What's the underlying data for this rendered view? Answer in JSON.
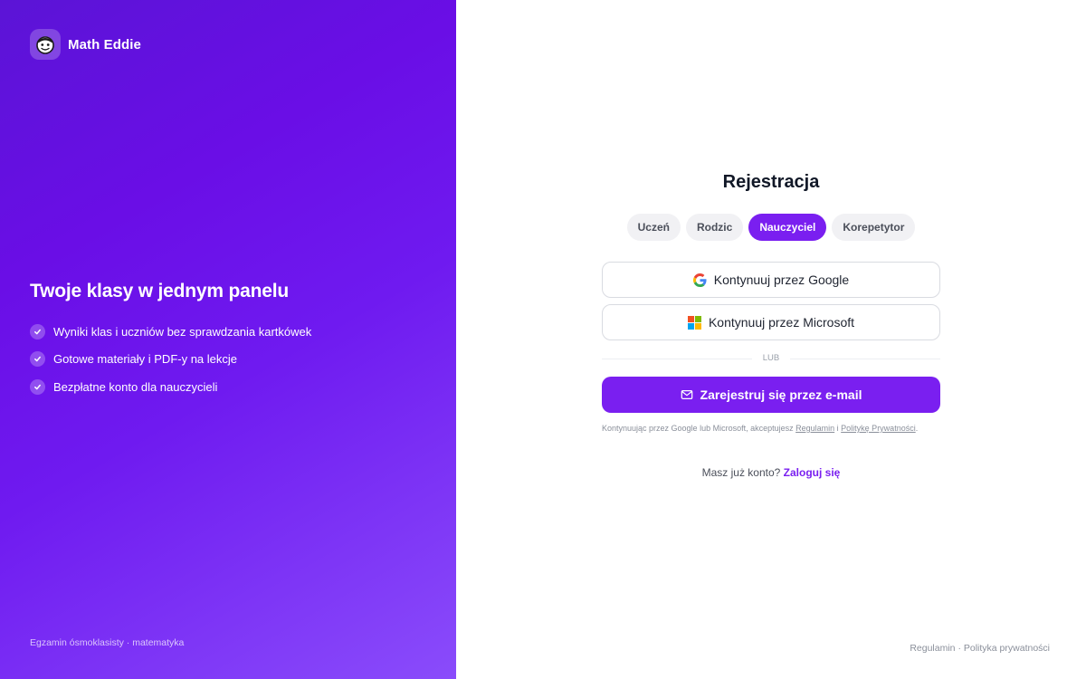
{
  "brand": {
    "name": "Math Eddie",
    "logo_icon": "mascot-face-icon"
  },
  "hero": {
    "title": "Twoje klasy w jednym panelu",
    "features": [
      "Wyniki klas i uczniów bez sprawdzania kartkówek",
      "Gotowe materiały i PDF-y na lekcje",
      "Bezpłatne konto dla nauczycieli"
    ]
  },
  "left_footer": "Egzamin ósmoklasisty · matematyka",
  "form": {
    "title": "Rejestracja",
    "tabs": [
      {
        "label": "Uczeń",
        "active": false
      },
      {
        "label": "Rodzic",
        "active": false
      },
      {
        "label": "Nauczyciel",
        "active": true
      },
      {
        "label": "Korepetytor",
        "active": false
      }
    ],
    "google_button": "Kontynuuj przez Google",
    "microsoft_button": "Kontynuuj przez Microsoft",
    "divider": "LUB",
    "email_button": "Zarejestruj się przez e-mail",
    "legal": {
      "prefix": "Kontynuując przez Google lub Microsoft, akceptujesz ",
      "terms_link": "Regulamin",
      "middle": " i ",
      "privacy_link": "Politykę Prywatności",
      "suffix": "."
    },
    "login_prompt": "Masz już konto? ",
    "login_link": "Zaloguj się"
  },
  "footer_links": {
    "terms": "Regulamin",
    "separator": " · ",
    "privacy": "Polityka prywatności"
  },
  "colors": {
    "accent": "#7a1ff0",
    "gradient_start": "#5b14d6",
    "gradient_end": "#8a4cfb"
  }
}
